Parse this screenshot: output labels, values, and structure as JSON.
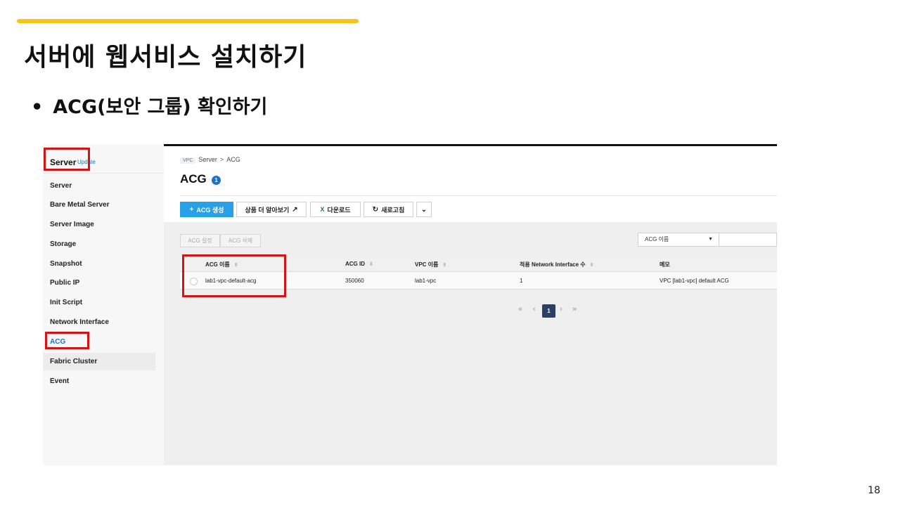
{
  "slide": {
    "title": "서버에 웹서비스 설치하기",
    "bullet_marker": "•",
    "bullet": "ACG(보안 그룹) 확인하기",
    "page_number": "18",
    "accent_color": "#f5c518"
  },
  "sidebar": {
    "title": "Server",
    "update_link": "Update",
    "items": [
      "Server",
      "Bare Metal Server",
      "Server Image",
      "Storage",
      "Snapshot",
      "Public IP",
      "Init Script",
      "Network Interface",
      "ACG",
      "Fabric Cluster",
      "Event"
    ],
    "active_item": "ACG"
  },
  "breadcrumb": {
    "vpc": "VPC",
    "parent": "Server",
    "separator": ">",
    "current": "ACG"
  },
  "page": {
    "heading": "ACG",
    "count": "1"
  },
  "toolbar": {
    "create": "ACG 생성",
    "learn_more": "상품 더 알아보기",
    "download": "다운로드",
    "refresh": "새로고침"
  },
  "actions": {
    "settings": "ACG 설정",
    "delete": "ACG 삭제"
  },
  "filter": {
    "selected": "ACG 이름"
  },
  "table": {
    "columns": [
      "ACG 이름",
      "ACG ID",
      "VPC 이름",
      "적용 Network Interface 수",
      "메모"
    ],
    "rows": [
      [
        "lab1-vpc-default-acg",
        "350060",
        "lab1-vpc",
        "1",
        "VPC [lab1-vpc] default ACG"
      ]
    ]
  },
  "pagination": {
    "current": "1"
  },
  "colors": {
    "primary": "#26a0e6",
    "highlight": "#d21414",
    "link": "#1a73c8"
  },
  "icons": [
    "plus-icon",
    "external-link-icon",
    "excel-icon",
    "refresh-icon",
    "chevron-down-icon",
    "sort-icon",
    "first-page-icon",
    "prev-page-icon",
    "next-page-icon",
    "last-page-icon"
  ]
}
